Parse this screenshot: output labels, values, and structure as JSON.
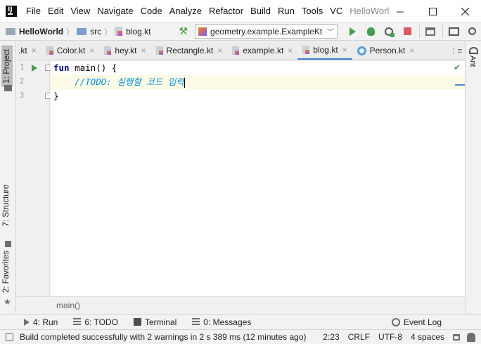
{
  "menubar": {
    "items": [
      "File",
      "Edit",
      "View",
      "Navigate",
      "Code",
      "Analyze",
      "Refactor",
      "Build",
      "Run",
      "Tools",
      "VC"
    ],
    "title": "HelloWorl"
  },
  "navbar": {
    "project": "HelloWorld",
    "folder": "src",
    "file": "blog.kt",
    "run_config": "geometry.example.ExampleKt"
  },
  "tabs": [
    {
      "label": ".kt",
      "type": "kotlin"
    },
    {
      "label": "Color.kt",
      "type": "kotlin"
    },
    {
      "label": "hey.kt",
      "type": "kotlin"
    },
    {
      "label": "Rectangle.kt",
      "type": "kotlin"
    },
    {
      "label": "example.kt",
      "type": "kotlin"
    },
    {
      "label": "blog.kt",
      "type": "kotlin",
      "active": true
    },
    {
      "label": "Person.kt",
      "type": "class"
    }
  ],
  "tabs_overflow": "⋮≡",
  "tab_close_glyph": "×",
  "editor": {
    "line_numbers": [
      "1",
      "2",
      "3"
    ],
    "line1_keyword": "fun",
    "line1_rest": " main() {",
    "line2_indent": "    ",
    "line2_comment": "//TODO: 실행할 코드 입력",
    "line3": "}",
    "breadcrumb": "main()"
  },
  "left_strip": {
    "project": "1: Project",
    "structure": "7: Structure",
    "favorites": "2: Favorites"
  },
  "right_strip": {
    "ant": "Ant"
  },
  "toolwindows": {
    "run": "4: Run",
    "todo": "6: TODO",
    "terminal": "Terminal",
    "messages": "0: Messages",
    "event_log": "Event Log"
  },
  "statusbar": {
    "message": "Build completed successfully with 2 warnings in 2 s 389 ms (12 minutes ago)",
    "position": "2:23",
    "line_sep": "CRLF",
    "encoding": "UTF-8",
    "indent": "4 spaces"
  },
  "colors": {
    "accent": "#4083c9",
    "run_green": "#499c54",
    "stop_red": "#db5860",
    "keyword": "#000080",
    "comment": "#008dde"
  }
}
